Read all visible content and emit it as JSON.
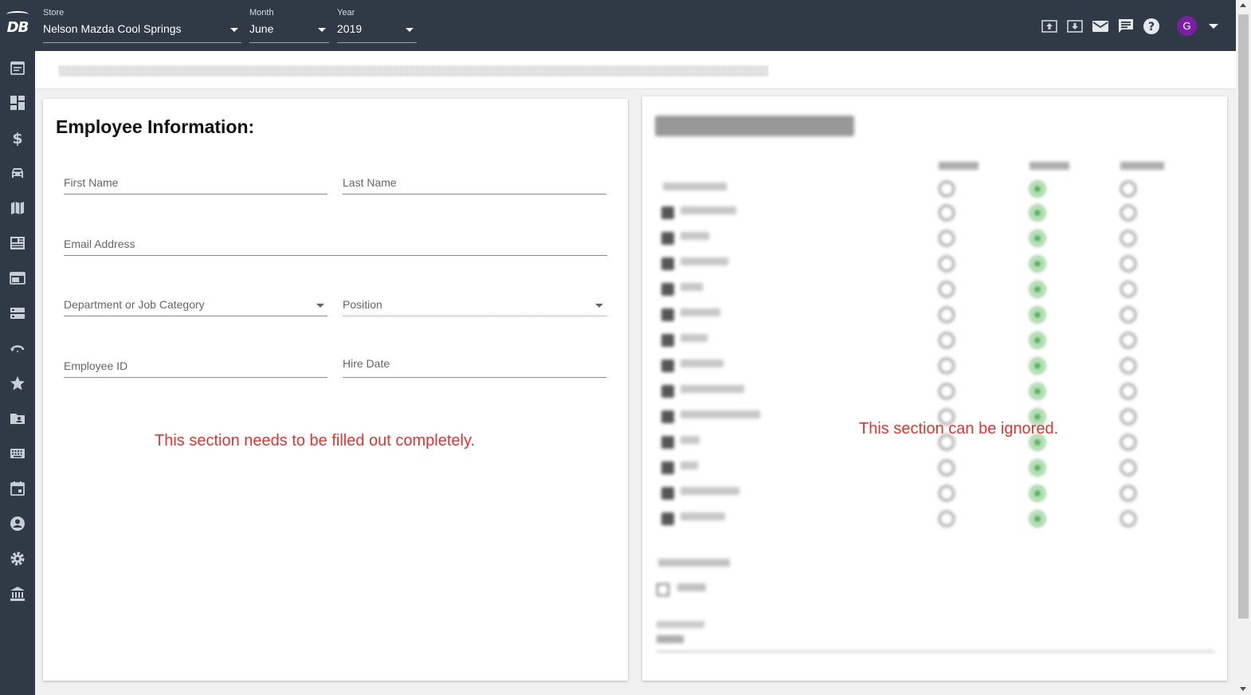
{
  "app": {
    "logo_text": "DB"
  },
  "selectors": {
    "store": {
      "label": "Store",
      "value": "Nelson Mazda Cool Springs"
    },
    "month": {
      "label": "Month",
      "value": "June"
    },
    "year": {
      "label": "Year",
      "value": "2019"
    }
  },
  "user": {
    "initial": "G",
    "avatar_color": "#7b1fa2"
  },
  "toolbar_icons": [
    "upload-icon",
    "download-icon",
    "mail-icon",
    "chat-icon",
    "help-icon"
  ],
  "sidebar_icons": [
    "calendar-note-icon",
    "dashboard-icon",
    "dollar-icon",
    "car-icon",
    "map-icon",
    "newspaper-icon",
    "web-icon",
    "storage-icon",
    "rotate-icon",
    "star-icon",
    "contact-folder-icon",
    "keyboard-icon",
    "event-icon",
    "account-circle-icon",
    "gear-icon",
    "bank-icon"
  ],
  "employee_info": {
    "title": "Employee Information:",
    "first_name": "First Name",
    "last_name": "Last Name",
    "email": "Email Address",
    "department": "Department or Job Category",
    "position": "Position",
    "employee_id": "Employee ID",
    "hire_date": "Hire Date",
    "note": "This section needs to be filled out completely."
  },
  "permissions": {
    "note": "This section can be ignored."
  },
  "colors": {
    "topbar_bg": "#2f3a46",
    "note_red": "#e8322a",
    "allowed_green": "#4caf50"
  }
}
